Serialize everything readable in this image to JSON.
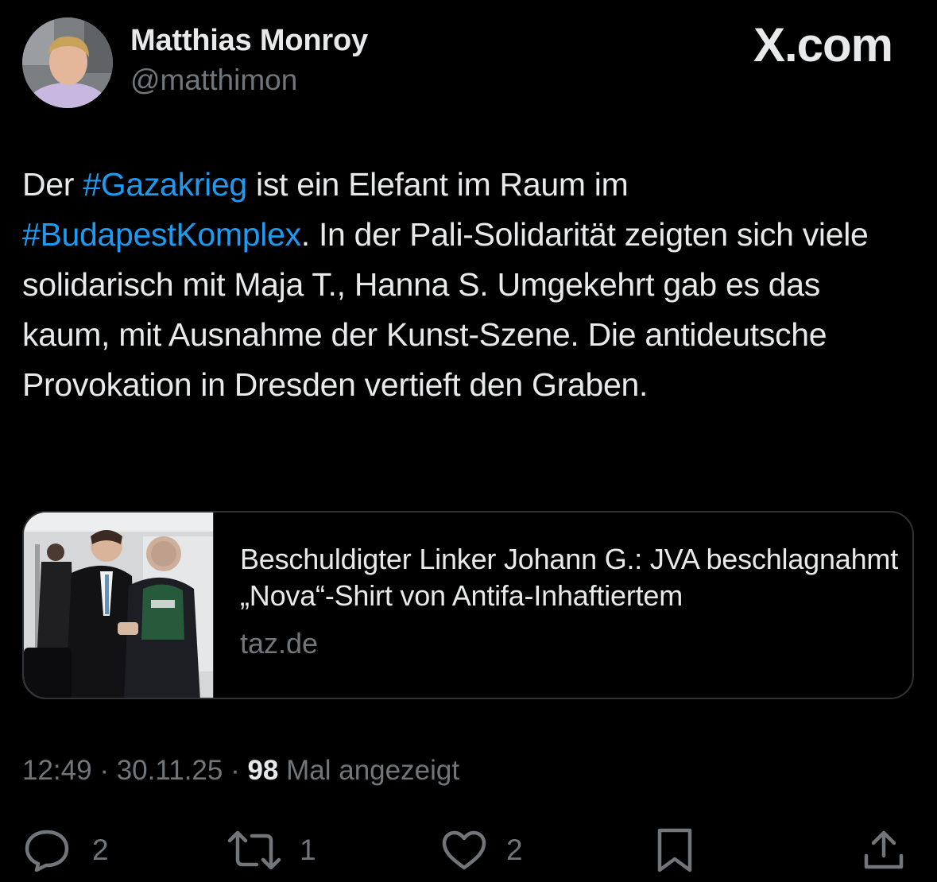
{
  "brand": "X.com",
  "author": {
    "name": "Matthias Monroy",
    "handle": "@matthimon"
  },
  "tweet": {
    "parts": [
      {
        "text": "Der ",
        "hashtag": false
      },
      {
        "text": "#Gazakrieg",
        "hashtag": true
      },
      {
        "text": " ist ein Elefant im Raum im ",
        "hashtag": false
      },
      {
        "text": "#BudapestKomplex",
        "hashtag": true
      },
      {
        "text": ". In der Pali-Solidarität zeigten sich viele solidarisch mit Maja T., Hanna S. Umgekehrt gab es das kaum, mit Ausnahme der Kunst-Szene. Die antideutsche Provokation in Dresden vertieft den Graben.",
        "hashtag": false
      }
    ]
  },
  "link_card": {
    "title": "Beschuldigter Linker Johann G.: JVA beschlagnahmt „Nova“-Shirt von Antifa-Inhaftiertem",
    "source": "taz.de"
  },
  "meta": {
    "time": "12:49",
    "separator": " · ",
    "date": "30.11.25",
    "views": "98",
    "views_label": " Mal angezeigt"
  },
  "actions": {
    "reply_count": "2",
    "repost_count": "1",
    "like_count": "2"
  },
  "colors": {
    "background": "#000000",
    "text": "#e7e9ea",
    "secondary": "#71767b",
    "link": "#1d9bf0",
    "border": "#2f3336"
  }
}
